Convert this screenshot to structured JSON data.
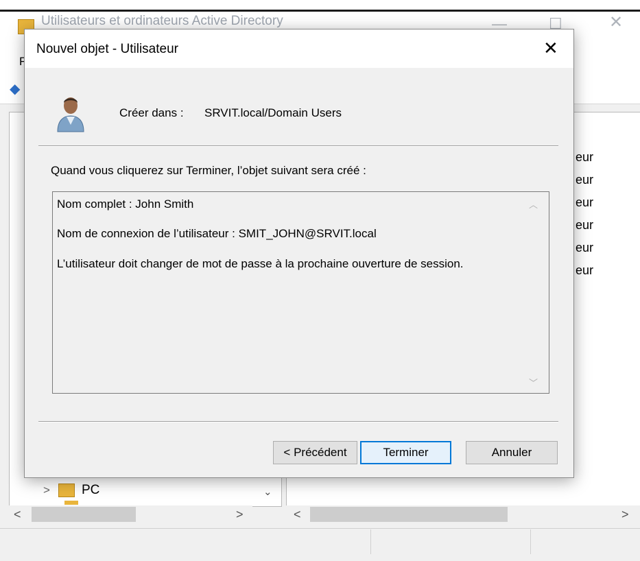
{
  "background_window": {
    "title": "Utilisateurs et ordinateurs Active Directory",
    "menu_fragment": "F",
    "list_fragments": [
      "eur",
      "eur",
      "eur",
      "eur",
      "eur",
      "eur"
    ],
    "tree_item_label": "PC",
    "controls": {
      "minimize": "—",
      "maximize": "☐",
      "close": "✕"
    }
  },
  "dialog": {
    "title": "Nouvel objet - Utilisateur",
    "close_glyph": "✕",
    "create_in_label": "Créer dans :",
    "create_in_path": "SRVIT.local/Domain Users",
    "instruction": "Quand vous cliquerez sur Terminer, l’objet suivant sera créé :",
    "summary_lines": [
      "Nom complet : John Smith",
      "Nom de connexion de l’utilisateur : SMIT_JOHN@SRVIT.local",
      "L’utilisateur doit changer de mot de passe à la prochaine ouverture de session."
    ],
    "buttons": {
      "back": "< Précédent",
      "finish": "Terminer",
      "cancel": "Annuler"
    }
  },
  "colors": {
    "accent": "#0078d7",
    "dialog_bg": "#f0f0f0",
    "folder": "#e9b53c"
  }
}
